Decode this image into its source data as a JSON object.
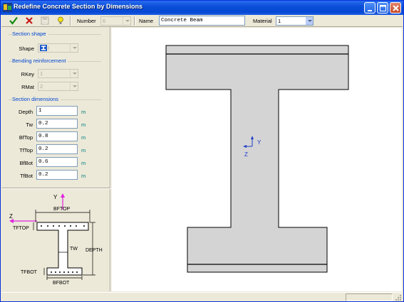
{
  "window": {
    "title": "Redefine Concrete Section by Dimensions"
  },
  "toolbar": {
    "number_label": "Number",
    "number_value": "6",
    "name_label": "Name",
    "name_value": "Concrete Beam",
    "material_label": "Material",
    "material_value": "1"
  },
  "section_shape": {
    "group_title": "Section shape",
    "shape_label": "Shape",
    "shape_value": "I"
  },
  "bending": {
    "group_title": "Bending reinforcement",
    "rkey_label": "RKey",
    "rkey_value": "1",
    "rmat_label": "RMat",
    "rmat_value": "2"
  },
  "dimensions": {
    "group_title": "Section dimensions",
    "unit": "m",
    "fields": [
      {
        "label": "Depth",
        "value": "1"
      },
      {
        "label": "Tw",
        "value": "0.2"
      },
      {
        "label": "BfTop",
        "value": "0.8"
      },
      {
        "label": "TfTop",
        "value": "0.2"
      },
      {
        "label": "BfBot",
        "value": "0.6"
      },
      {
        "label": "TfBot",
        "value": "0.2"
      }
    ]
  },
  "sketch": {
    "y_axis": "Y",
    "z_axis": "Z",
    "bftop": "BFTOP",
    "tftop": "TFTOP",
    "tw": "TW",
    "depth": "DEPTH",
    "tfbot": "TFBOT",
    "bfbot": "BFBOT"
  },
  "canvas": {
    "y_axis": "Y",
    "z_axis": "Z",
    "section_fill": "#D4D4D4"
  }
}
